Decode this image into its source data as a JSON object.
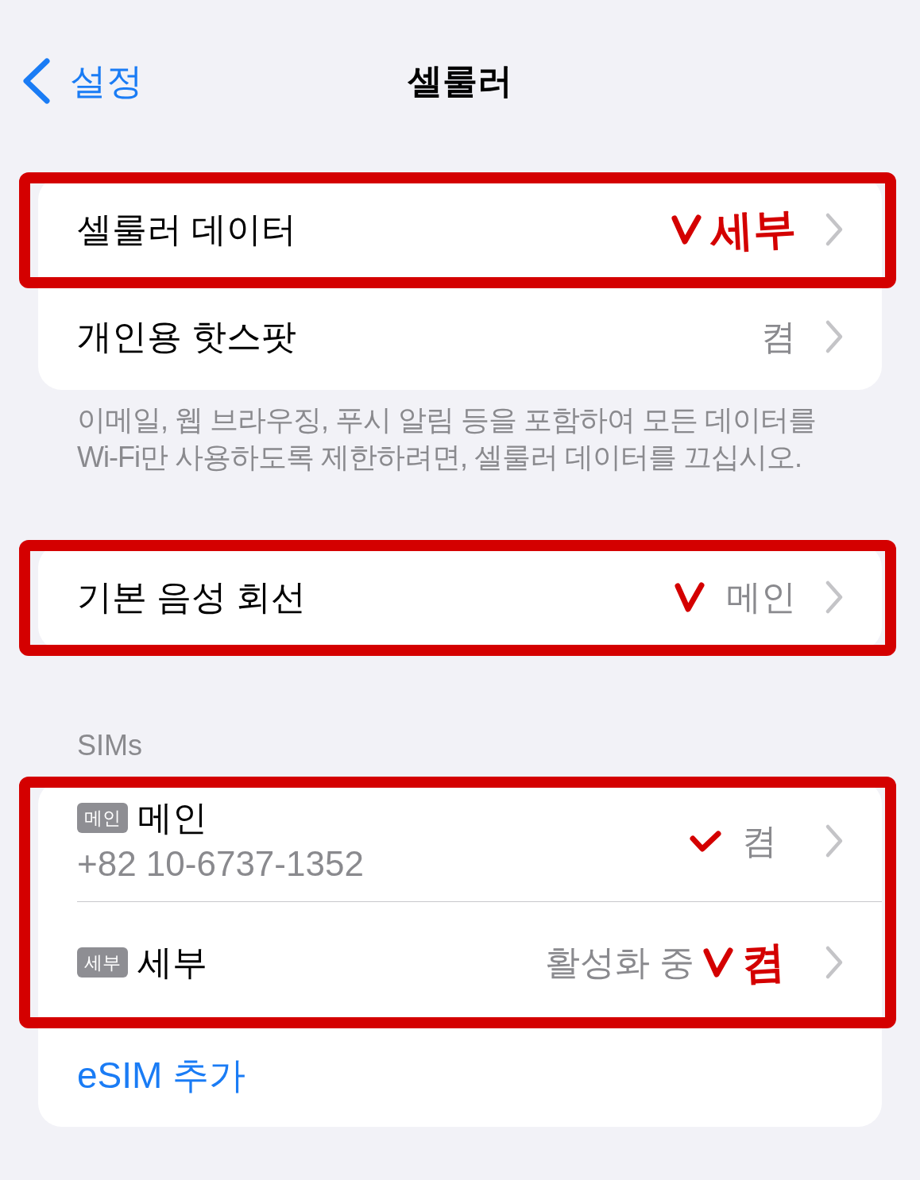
{
  "nav": {
    "back_label": "설정",
    "title": "셀룰러"
  },
  "groups": [
    {
      "rows": [
        {
          "kind": "nav",
          "label": "셀룰러 데이터",
          "outlined": true,
          "check": true,
          "handwriting": "세부"
        },
        {
          "kind": "nav",
          "label": "개인용 핫스팟",
          "value": "켬",
          "outlined": false,
          "check": false
        }
      ],
      "footer": "이메일, 웹 브라우징, 푸시 알림 등을 포함하여 모든 데이터를 Wi-Fi만 사용하도록 제한하려면, 셀룰러 데이터를 끄십시오."
    },
    {
      "rows": [
        {
          "kind": "nav",
          "label": "기본 음성 회선",
          "value": "메인",
          "outlined": true,
          "check": true
        }
      ]
    },
    {
      "header": "SIMs",
      "rows": [
        {
          "kind": "sim",
          "badge": "메인",
          "label": "메인",
          "subtitle": "+82 10-6737-1352",
          "value": "켬",
          "outlined": true,
          "check": true
        },
        {
          "kind": "sim",
          "badge": "세부",
          "label": "세부",
          "value": "활성화 중",
          "outlined": true,
          "check": true,
          "handwriting": "켬"
        },
        {
          "kind": "action",
          "label": "eSIM 추가",
          "outlined": false,
          "check": false
        }
      ]
    }
  ]
}
